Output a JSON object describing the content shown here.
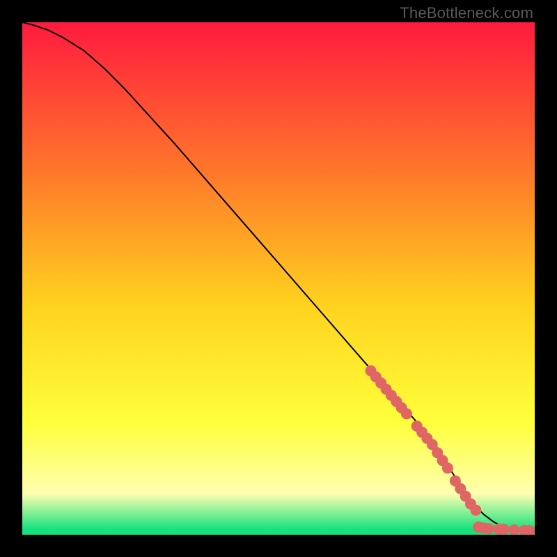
{
  "caption": "TheBottleneck.com",
  "colors": {
    "gradient_top": "#ff1a3f",
    "gradient_mid1": "#ff7a2a",
    "gradient_mid2": "#ffd21f",
    "gradient_mid3": "#ffff3a",
    "gradient_pale": "#ffffb0",
    "gradient_green": "#15e27d",
    "curve": "#000000",
    "marker": "#e06666",
    "frame": "#000000"
  },
  "chart_data": {
    "type": "line",
    "title": "",
    "xlabel": "",
    "ylabel": "",
    "xlim": [
      0,
      100
    ],
    "ylim": [
      0,
      100
    ],
    "series": [
      {
        "name": "curve",
        "x": [
          0,
          2,
          5,
          8,
          12,
          16,
          20,
          30,
          40,
          50,
          60,
          70,
          80,
          84,
          86,
          88,
          90,
          92,
          94,
          96,
          98,
          100
        ],
        "y": [
          100,
          99.5,
          98.5,
          97,
          94.5,
          91,
          87,
          76,
          64.5,
          53,
          41.5,
          30,
          18.5,
          12,
          9,
          6,
          4,
          2.5,
          1.5,
          1,
          0.8,
          0.7
        ]
      }
    ],
    "markers": [
      {
        "x": 68,
        "y": 32
      },
      {
        "x": 69,
        "y": 30.8
      },
      {
        "x": 70,
        "y": 29.6
      },
      {
        "x": 71,
        "y": 28.4
      },
      {
        "x": 72,
        "y": 27.2
      },
      {
        "x": 73,
        "y": 26
      },
      {
        "x": 74,
        "y": 24.8
      },
      {
        "x": 75,
        "y": 23.6
      },
      {
        "x": 77,
        "y": 21.2
      },
      {
        "x": 78,
        "y": 20
      },
      {
        "x": 79,
        "y": 18.8
      },
      {
        "x": 80,
        "y": 17.6
      },
      {
        "x": 81,
        "y": 16
      },
      {
        "x": 82,
        "y": 14.5
      },
      {
        "x": 83,
        "y": 13
      },
      {
        "x": 84.5,
        "y": 10.5
      },
      {
        "x": 85.5,
        "y": 9
      },
      {
        "x": 86.5,
        "y": 7.5
      },
      {
        "x": 87.5,
        "y": 6
      },
      {
        "x": 88.5,
        "y": 4.8
      },
      {
        "x": 89,
        "y": 1.5
      },
      {
        "x": 90,
        "y": 1.3
      },
      {
        "x": 91,
        "y": 1.2
      },
      {
        "x": 93,
        "y": 1.1
      },
      {
        "x": 94,
        "y": 1.05
      },
      {
        "x": 96,
        "y": 0.95
      },
      {
        "x": 98,
        "y": 0.85
      },
      {
        "x": 99,
        "y": 0.8
      }
    ]
  }
}
